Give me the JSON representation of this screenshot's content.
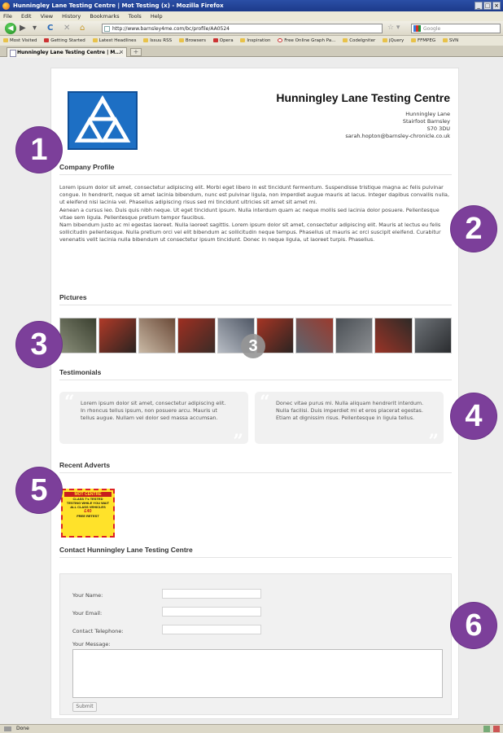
{
  "browser": {
    "window_title": "Hunningley Lane Testing Centre | Mot Testing (x) - Mozilla Firefox",
    "menu": [
      "File",
      "Edit",
      "View",
      "History",
      "Bookmarks",
      "Tools",
      "Help"
    ],
    "url": "http://www.barnsley4me.com/bc/profile/AA0524",
    "search_placeholder": "Google",
    "bookmarks": [
      "Most Visited",
      "Getting Started",
      "Latest Headlines",
      "Issuu RSS",
      "Browsers",
      "Opera",
      "Inspiration",
      "Free Online Graph Pa...",
      "CodeIgniter",
      "jQuery",
      "FFMPEG",
      "SVN"
    ],
    "tab_title": "Hunningley Lane Testing Centre | M...",
    "status": "Done"
  },
  "centre": {
    "name": "Hunningley Lane Testing Centre",
    "address": [
      "Hunningley Lane",
      "Stairfoot Barnsley",
      "S70 3DU",
      "sarah.hopton@barnsley-chronicle.co.uk"
    ]
  },
  "sections": {
    "profile": "Company Profile",
    "pictures": "Pictures",
    "testimonials": "Testimonials",
    "adverts": "Recent Adverts",
    "contact": "Contact Hunningley Lane Testing Centre"
  },
  "profile_text": [
    "Lorem ipsum dolor sit amet, consectetur adipiscing elit. Morbi eget libero in est tincidunt fermentum. Suspendisse tristique magna ac felis pulvinar congue. In hendrerit, neque sit amet lacinia bibendum, nunc est pulvinar ligula, non imperdiet augue mauris at lacus. Integer dapibus convallis nulla, ut eleifend nisi lacinia vel. Phasellus adipiscing risus sed mi tincidunt ultricies sit amet sit amet mi.",
    "Aenean a cursus leo. Duis quis nibh neque. Ut eget tincidunt ipsum. Nulla interdum quam ac neque mollis sed lacinia dolor posuere. Pellentesque vitae sem ligula. Pellentesque pretium tempor faucibus.",
    "Nam bibendum justo ac mi egestas laoreet. Nulla laoreet sagittis. Lorem ipsum dolor sit amet, consectetur adipiscing elit. Mauris at lectus eu felis sollicitudin pellentesque. Nulla pretium orci vel elit bibendum ac sollicitudin neque tempus. Phasellus ut mauris ac orci suscipit eleifend. Curabitur venenatis velit lacinia nulla bibendum ut consectetur ipsum tincidunt. Donec in neque ligula, ut laoreet turpis. Phasellus."
  ],
  "pictures": [
    {
      "c1": "#8a8f7a",
      "c2": "#3b4030"
    },
    {
      "c1": "#b03a28",
      "c2": "#2a2320"
    },
    {
      "c1": "#c9b9a5",
      "c2": "#6b4a38"
    },
    {
      "c1": "#9e2f22",
      "c2": "#3a2b26"
    },
    {
      "c1": "#b7bcc4",
      "c2": "#505866"
    },
    {
      "c1": "#a63524",
      "c2": "#2b2422"
    },
    {
      "c1": "#5d6670",
      "c2": "#9a3a2e"
    },
    {
      "c1": "#4a4f55",
      "c2": "#8c8f92"
    },
    {
      "c1": "#9b3427",
      "c2": "#2e2a27"
    },
    {
      "c1": "#6e7378",
      "c2": "#2a2c2f"
    }
  ],
  "testimonials": [
    "Lorem ipsum dolor sit amet, consectetur adipiscing elit. In rhoncus tellus ipsum, non posuere arcu. Mauris ut tellus augue. Nullam vel dolor sed massa accumsan.",
    "Donec vitae purus mi. Nulla aliquam hendrerit interdum. Nulla facilisi. Duis imperdiet mi et eros placerat egestas. Etiam at dignissim risus. Pellentesque in ligula tellus."
  ],
  "advert": {
    "title": "MOT CENTRE",
    "lines": [
      "CLASS 7's TESTED",
      "TESTING WHILE YOU WAIT",
      "ALL CLASS VEHICLES"
    ],
    "price": "£40",
    "footer": "FREE RETEST"
  },
  "form": {
    "name_label": "Your Name:",
    "email_label": "Your Email:",
    "phone_label": "Contact Telephone:",
    "message_label": "Your Message:",
    "submit_label": "Submit"
  },
  "badges": [
    "1",
    "2",
    "3",
    "4",
    "5",
    "6"
  ],
  "pictures_overlay_badge": "3",
  "colors": {
    "badge": "#7c3f9a",
    "logo_blue": "#1d6fc4"
  }
}
